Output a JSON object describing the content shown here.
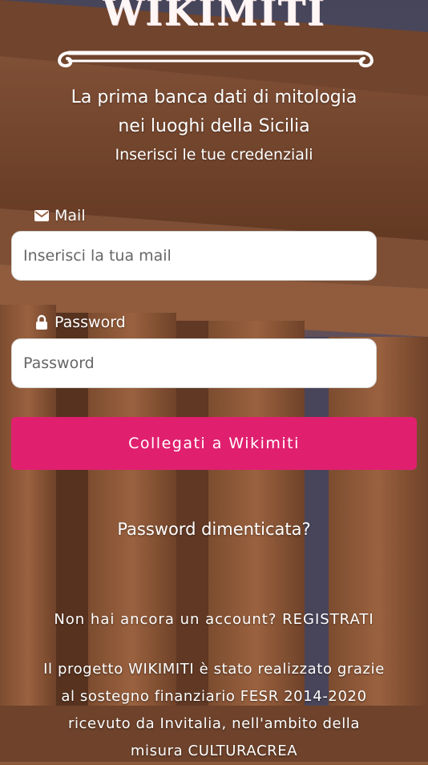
{
  "app": {
    "logo_text": "WIKIMITI",
    "tagline_line1": "La prima banca dati di mitologia",
    "tagline_line2": "nei luoghi della Sicilia",
    "subtitle": "Inserisci le tue credenziali"
  },
  "form": {
    "mail_label": "Mail",
    "mail_placeholder": "Inserisci la tua mail",
    "password_label": "Password",
    "password_placeholder": "Password",
    "login_button": "Collegati a Wikimiti",
    "forgot_password": "Password dimenticata?"
  },
  "register": {
    "prompt": "Non hai ancora un account?",
    "link": "REGISTRATI"
  },
  "footer": {
    "line1": "Il progetto WIKIMITI è stato realizzato grazie",
    "line2": "al sostegno finanziario FESR 2014-2020",
    "line3": "ricevuto da Invitalia, nell'ambito della",
    "line4": "misura CULTURACREA"
  },
  "icons": {
    "mail": "mail-icon",
    "password": "lock-icon"
  },
  "colors": {
    "accent": "#e0206f",
    "text": "#ffffff",
    "input_bg": "#ffffff"
  }
}
